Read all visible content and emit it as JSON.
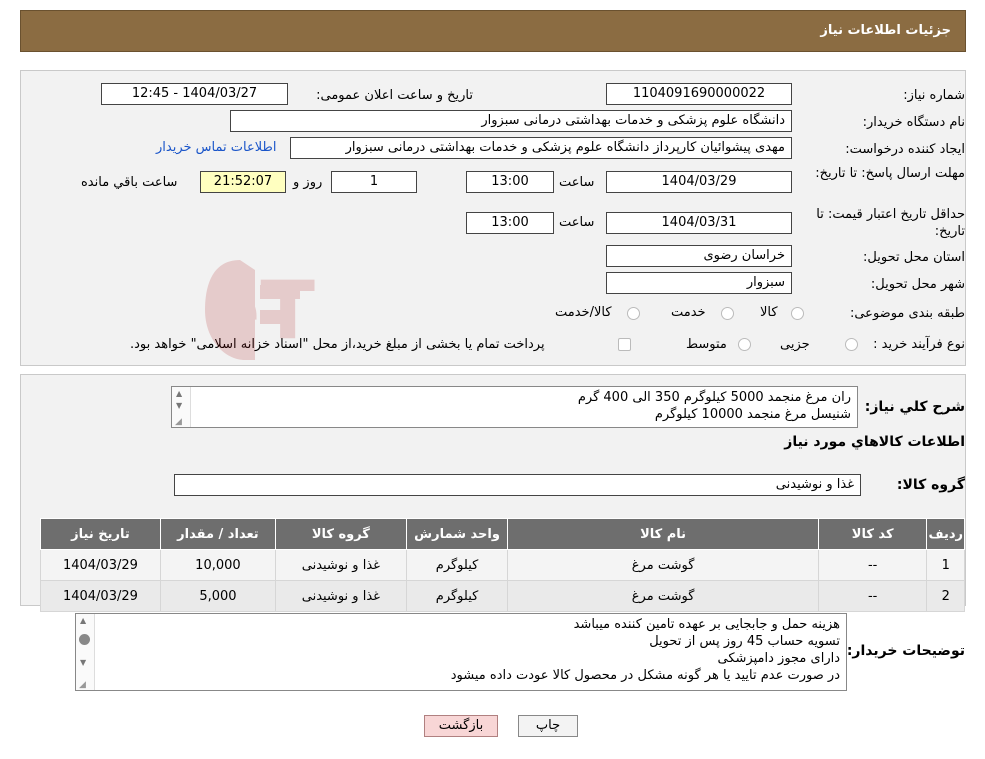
{
  "header": {
    "title": "جزئیات اطلاعات نیاز"
  },
  "form": {
    "need_number_label": "شماره نیاز:",
    "need_number": "1104091690000022",
    "announce_label": "تاریخ و ساعت اعلان عمومی:",
    "announce_value": "1404/03/27 - 12:45",
    "buyer_org_label": "نام دستگاه خریدار:",
    "buyer_org": "دانشگاه علوم پزشکی و خدمات بهداشتی  درمانی سبزوار",
    "requester_label": "ایجاد کننده درخواست:",
    "requester": "مهدی پیشوائیان کارپرداز دانشگاه علوم پزشکی و خدمات بهداشتی  درمانی سبزوار",
    "contact_link": "اطلاعات تماس خریدار",
    "reply_deadline_label": "مهلت ارسال پاسخ: تا تاریخ:",
    "reply_date": "1404/03/29",
    "time_label": "ساعت",
    "reply_time": "13:00",
    "days_value": "1",
    "days_label": "روز و",
    "remaining_time": "21:52:07",
    "remaining_label": "ساعت باقي مانده",
    "price_validity_label": "حداقل تاریخ اعتبار قیمت: تا تاریخ:",
    "price_date": "1404/03/31",
    "price_time": "13:00",
    "province_label": "استان محل تحویل:",
    "province": "خراسان رضوی",
    "city_label": "شهر محل تحویل:",
    "city": "سبزوار",
    "category_label": "طبقه بندی موضوعی:",
    "category_options": [
      "کالا",
      "خدمت",
      "کالا/خدمت"
    ],
    "process_label": "نوع فرآیند خرید :",
    "process_options": [
      "جزیی",
      "متوسط"
    ],
    "process_note": "پرداخت تمام یا بخشی از مبلغ خرید،از محل \"اسناد خزانه اسلامی\" خواهد بود."
  },
  "summary": {
    "label": "شرح کلي نياز:",
    "lines": [
      "ران مرغ منجمد 5000 کیلوگرم 350 الی 400 گرم",
      "شنیسل مرغ منجمد 10000 کیلوگرم"
    ]
  },
  "goods": {
    "section_title": "اطلاعات کالاهاي مورد نياز",
    "group_label": "گروه کالا:",
    "group_value": "غذا و نوشیدنی",
    "columns": [
      "رديف",
      "کد کالا",
      "نام کالا",
      "واحد شمارش",
      "گروه کالا",
      "تعداد / مقدار",
      "تاریخ نیاز"
    ],
    "rows": [
      [
        "1",
        "--",
        "گوشت مرغ",
        "کیلوگرم",
        "غذا و نوشیدنی",
        "10,000",
        "1404/03/29"
      ],
      [
        "2",
        "--",
        "گوشت مرغ",
        "کیلوگرم",
        "غذا و نوشیدنی",
        "5,000",
        "1404/03/29"
      ]
    ]
  },
  "notes": {
    "label": "توضیحات خریدار:",
    "lines": [
      "هزینه حمل و جابجایی بر عهده تامین کننده میباشد",
      "تسویه حساب 45 روز پس از تحویل",
      "دارای مجوز دامپزشکی",
      "در صورت عدم تایید یا هر گونه مشکل در محصول کالا عودت داده میشود"
    ]
  },
  "buttons": {
    "print": "چاپ",
    "back": "بازگشت"
  },
  "watermark": {
    "text": "AriaTender.neT"
  }
}
